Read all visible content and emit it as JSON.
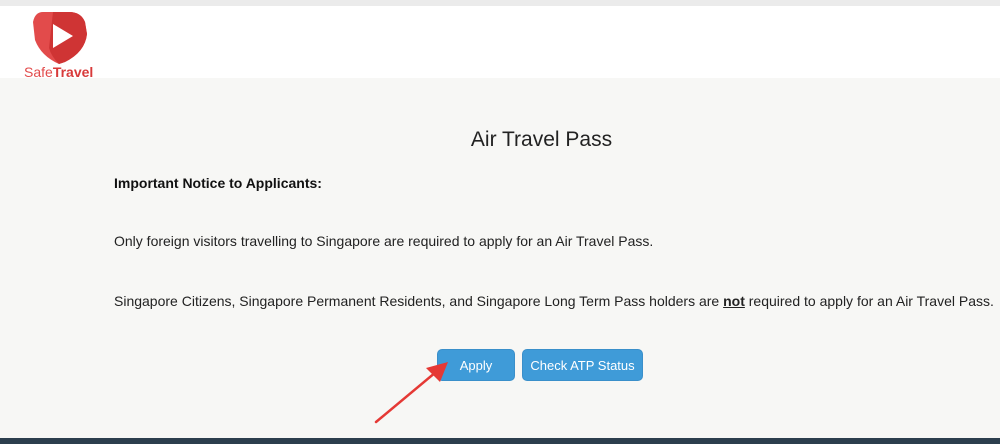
{
  "brand": {
    "name_part1": "Safe",
    "name_part2": "Travel",
    "colors": {
      "primary": "#e24b4b"
    },
    "icon": "play-shield-logo-icon"
  },
  "page": {
    "title": "Air Travel Pass"
  },
  "notice": {
    "heading": "Important Notice to Applicants:",
    "line1": "Only foreign visitors travelling to Singapore are required to apply for an Air Travel Pass.",
    "line2_before": "Singapore Citizens, Singapore Permanent Residents, and Singapore Long Term Pass holders are ",
    "line2_emphasis": "not",
    "line2_after": " required to apply for an Air Travel Pass."
  },
  "actions": {
    "apply_label": "Apply",
    "check_status_label": "Check ATP Status",
    "button_color": "#3f9bd8"
  },
  "annotation": {
    "arrow_color": "#e53935",
    "arrow_icon": "red-arrow-icon"
  }
}
